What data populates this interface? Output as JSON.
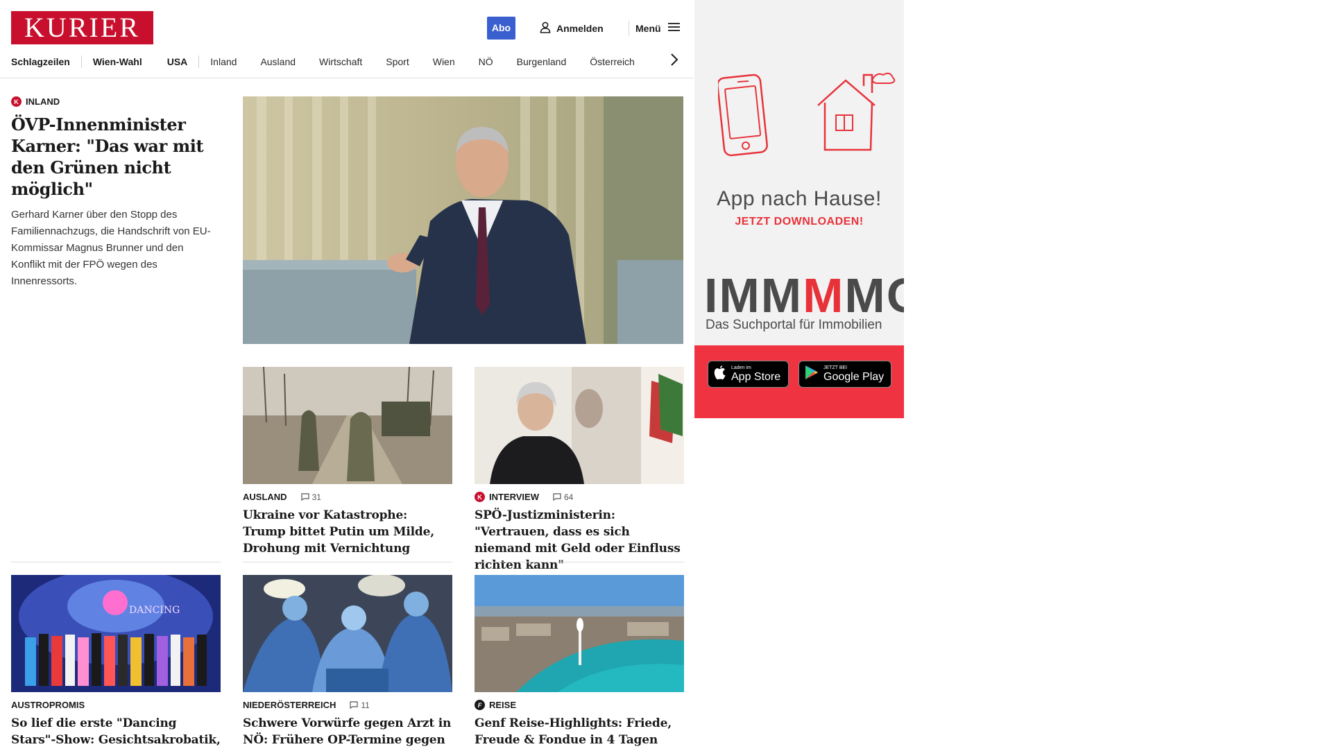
{
  "header": {
    "logo": "KURIER",
    "abo": "Abo",
    "login": "Anmelden",
    "menu": "Menü"
  },
  "nav": {
    "items": [
      "Schlagzeilen",
      "Wien-Wahl",
      "USA",
      "Inland",
      "Ausland",
      "Wirtschaft",
      "Sport",
      "Wien",
      "NÖ",
      "Burgenland",
      "Österreich"
    ]
  },
  "lead": {
    "badge": "K",
    "kicker": "INLAND",
    "headline": "ÖVP-Innenminister Karner: \"Das war mit den Grünen nicht möglich\"",
    "teaser": "Gerhard Karner über den Stopp des Familiennachzugs, die Handschrift von EU-Kommissar Magnus Brunner und den Konflikt mit der FPÖ wegen des Innenressorts."
  },
  "cards": [
    {
      "badge": "",
      "kicker": "AUSLAND",
      "comments": "31",
      "headline": "Ukraine vor Katastrophe: Trump bittet Putin um Milde, Drohung mit Vernichtung"
    },
    {
      "badge": "K",
      "kicker": "INTERVIEW",
      "comments": "64",
      "headline": "SPÖ-Justizministerin: \"Vertrauen, dass es sich niemand mit Geld oder Einfluss richten kann\""
    },
    {
      "badge": "",
      "kicker": "AUSTROPROMIS",
      "comments": "",
      "headline": "So lief die erste \"Dancing Stars\"-Show: Gesichtsakrobatik, Aussetzer und Kernöl-Adonis"
    },
    {
      "badge": "",
      "kicker": "NIEDERÖSTERREICH",
      "comments": "11",
      "headline": "Schwere Vorwürfe gegen Arzt in NÖ: Frühere OP-Termine gegen Bezahlung?"
    },
    {
      "badge": "f",
      "kicker": "REISE",
      "comments": "",
      "headline": "Genf Reise-Highlights: Friede, Freude & Fondue in 4 Tagen"
    }
  ],
  "ad": {
    "title": "App nach Hause!",
    "subtitle": "JETZT DOWNLOADEN!",
    "brand_a": "IMM",
    "brand_b": "M",
    "brand_c": "MO",
    "tagline": "Das Suchportal für Immobilien",
    "appstore_small": "Laden im",
    "appstore_big": "App Store",
    "googleplay_small": "JETZT BEI",
    "googleplay_big": "Google Play"
  },
  "colors": {
    "brand_red": "#c8102e",
    "abo_blue": "#3a5fcf",
    "ad_red": "#ef3340"
  },
  "icons": [
    "user-icon",
    "hamburger-icon",
    "chevron-right-icon",
    "comment-icon",
    "phone-icon",
    "house-icon",
    "apple-icon",
    "google-play-icon"
  ]
}
